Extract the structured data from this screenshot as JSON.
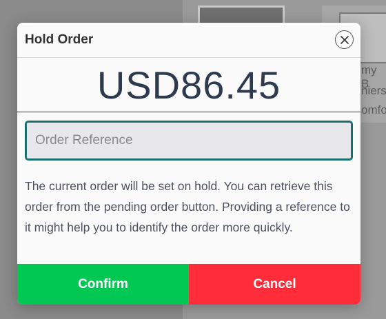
{
  "background": {
    "text_lines": [
      "my B",
      "niers",
      "omfor"
    ]
  },
  "modal": {
    "title": "Hold Order",
    "close_icon": "close-icon",
    "amount": "USD86.45",
    "reference_input": {
      "placeholder": "Order Reference",
      "value": ""
    },
    "description": "The current order will be set on hold. You can retrieve this order from the pending order button. Providing a reference to it might help you to identify the order more quickly.",
    "confirm_label": "Confirm",
    "cancel_label": "Cancel"
  },
  "colors": {
    "confirm": "#00c853",
    "cancel": "#ff2d3a",
    "amount_text": "#2e3a4d",
    "input_border": "#1f6e6e"
  }
}
